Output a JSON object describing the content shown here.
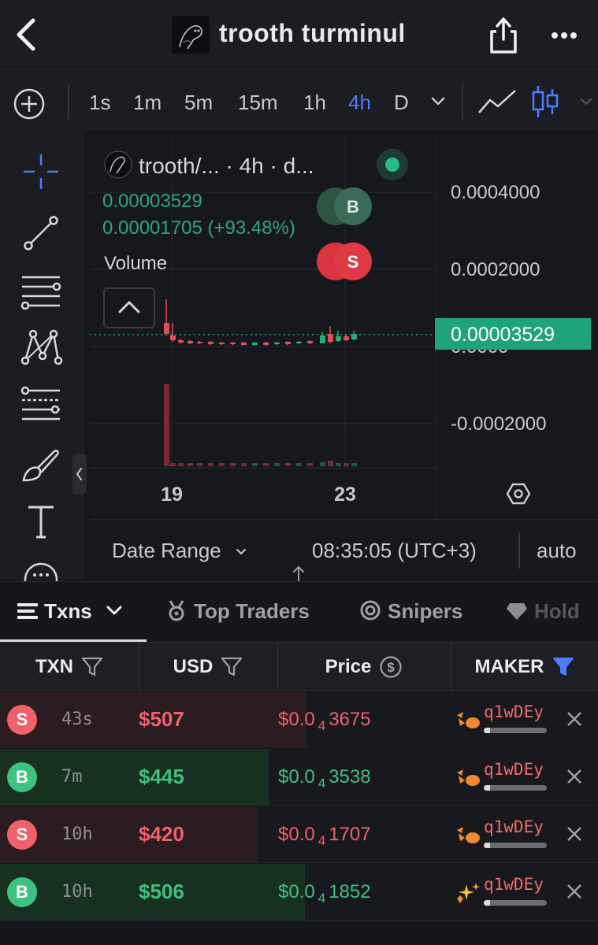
{
  "header": {
    "title": "trooth turminul"
  },
  "timeframes": {
    "items": [
      "1s",
      "1m",
      "5m",
      "15m",
      "1h",
      "4h",
      "D"
    ],
    "active": "4h"
  },
  "chart": {
    "legend": "trooth/... · 4h · d...",
    "price": "0.00003529",
    "change": "0.00001705 (+93.48%)",
    "volume_label": "Volume",
    "buy_marker": "B",
    "sell_marker": "S",
    "last_price_label": "0.00003529",
    "colors": {
      "up": "#2ea77a",
      "down": "#e14c59",
      "accent": "#4a7dff",
      "price_tag": "#1fa37c"
    }
  },
  "chart_data": {
    "type": "candlestick",
    "y_ticks": [
      "0.0004000",
      "0.0002000",
      "0.0000",
      "-0.0002000"
    ],
    "x_ticks": [
      "19",
      "23"
    ],
    "last_price": 3.529e-05,
    "grid": true
  },
  "chart_footer": {
    "date_range": "Date Range",
    "time": "08:35:05 (UTC+3)",
    "auto": "auto"
  },
  "tabs": [
    {
      "label": "Txns"
    },
    {
      "label": "Top Traders"
    },
    {
      "label": "Snipers"
    },
    {
      "label": "Hold"
    }
  ],
  "table": {
    "columns": [
      "TXN",
      "USD",
      "Price",
      "MAKER"
    ],
    "rows": [
      {
        "type": "S",
        "age": "43s",
        "usd": "$507",
        "price_prefix": "$0.0",
        "price_zeros": "4",
        "price_digits": "3675",
        "maker": "q1wDEy"
      },
      {
        "type": "B",
        "age": "7m",
        "usd": "$445",
        "price_prefix": "$0.0",
        "price_zeros": "4",
        "price_digits": "3538",
        "maker": "q1wDEy"
      },
      {
        "type": "S",
        "age": "10h",
        "usd": "$420",
        "price_prefix": "$0.0",
        "price_zeros": "4",
        "price_digits": "1707",
        "maker": "q1wDEy"
      },
      {
        "type": "B",
        "age": "10h",
        "usd": "$506",
        "price_prefix": "$0.0",
        "price_zeros": "4",
        "price_digits": "1852",
        "maker": "q1wDEy"
      }
    ]
  }
}
